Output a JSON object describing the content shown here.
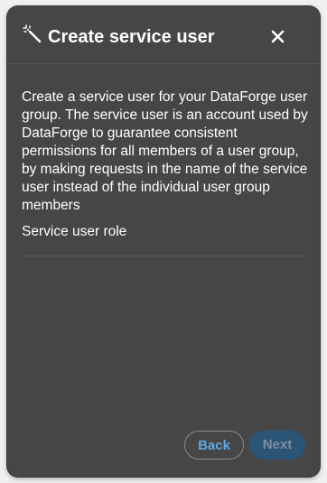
{
  "dialog": {
    "title": "Create service user",
    "description": "Create a service user for your DataForge user group. The service user is an account used by DataForge to guarantee consistent permissions for all members of a user group, by making requests in the name of the service user instead of the individual user group members",
    "role_label": "Service user role",
    "back_label": "Back",
    "next_label": "Next",
    "next_enabled": false
  },
  "icons": {
    "header": "magic-wand-icon",
    "close": "close-icon"
  },
  "colors": {
    "dialog_background": "#464646",
    "text": "#ffffff",
    "accent": "#5aa9e6",
    "next_disabled_background": "#2b5577",
    "next_disabled_text": "#7d8ea0"
  }
}
